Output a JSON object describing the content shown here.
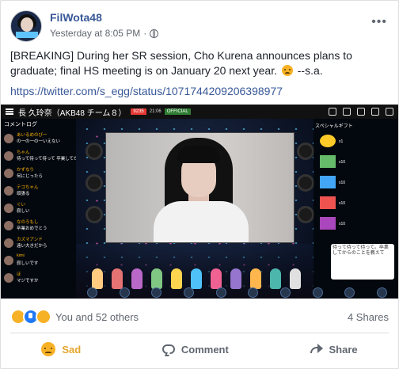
{
  "post": {
    "page_name": "FilWota48",
    "timestamp": "Yesterday at 8:05 PM",
    "separator": "·",
    "text_line1": "[BREAKING] During her SR session, Cho Kurena announces plans to",
    "text_line2_part1": "graduate; final HS meeting is on January 20 next year.",
    "text_line2_part2": "--s.a.",
    "link": "https://twitter.com/s_egg/status/1071744209206398977"
  },
  "media": {
    "stream_title": "長 久玲奈（AKB48 チーム８）",
    "viewer_badge": "9235",
    "time_badge": "21:06",
    "official_badge": "OFFICIAL",
    "comment_header": "コメントログ",
    "gift_header": "スペシャルギフト",
    "bubble_text": "待って待って待って。卒業してからのことを教えて",
    "comments": [
      {
        "name": "あいるめのびー",
        "text": "の一の一の一いえない"
      },
      {
        "name": "ちゃん",
        "text": "待って待って待って 卒業してからのこと"
      },
      {
        "name": "かずなり",
        "text": "何にじったら"
      },
      {
        "name": "テコちゃん",
        "text": "頑張る"
      },
      {
        "name": "ぐい",
        "text": "寂しい"
      },
      {
        "name": "なのろもし",
        "text": "卒業おめでとう"
      },
      {
        "name": "カズマアンド",
        "text": "遠い大きだから"
      },
      {
        "name": "kimi",
        "text": "寂しいです"
      },
      {
        "name": "ほ",
        "text": "マジですか"
      }
    ],
    "gift_counts": [
      "x1",
      "x10",
      "x10",
      "x10",
      "x10"
    ]
  },
  "engagement": {
    "reactions_text": "You and 52 others",
    "shares_text": "4 Shares"
  },
  "actions": {
    "sad_label": "Sad",
    "comment_label": "Comment",
    "share_label": "Share"
  },
  "colors": {
    "link_blue": "#385898",
    "sad_yellow": "#f7b125",
    "like_blue": "#2078f4",
    "muted": "#606770"
  }
}
